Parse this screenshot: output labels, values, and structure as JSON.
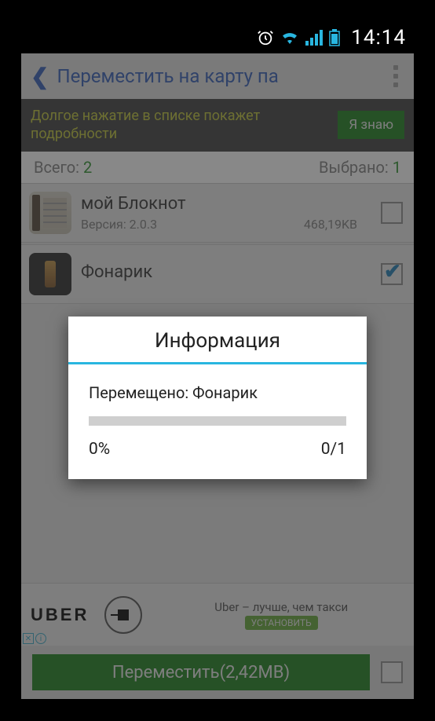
{
  "status_bar": {
    "time": "14:14"
  },
  "header": {
    "title": "Переместить на карту па"
  },
  "tip": {
    "text": "Долгое нажатие в списке покажет подробности",
    "button": "Я знаю"
  },
  "stats": {
    "total_label": "Всего:",
    "total_value": "2",
    "selected_label": "Выбрано:",
    "selected_value": "1"
  },
  "apps": [
    {
      "name": "мой Блокнот",
      "version_label": "Версия: 2.0.3",
      "size": "468,19KB",
      "checked": false
    },
    {
      "name": "Фонарик",
      "version_label": "",
      "size": "",
      "checked": true
    }
  ],
  "ad": {
    "brand": "UBER",
    "tagline": "Uber – лучше, чем такси",
    "install": "УСТАНОВИТЬ"
  },
  "bottom": {
    "move_button": "Переместить(2,42MB)"
  },
  "modal": {
    "title": "Информация",
    "status": "Перемещено: Фонарик",
    "percent": "0%",
    "count": "0/1"
  }
}
